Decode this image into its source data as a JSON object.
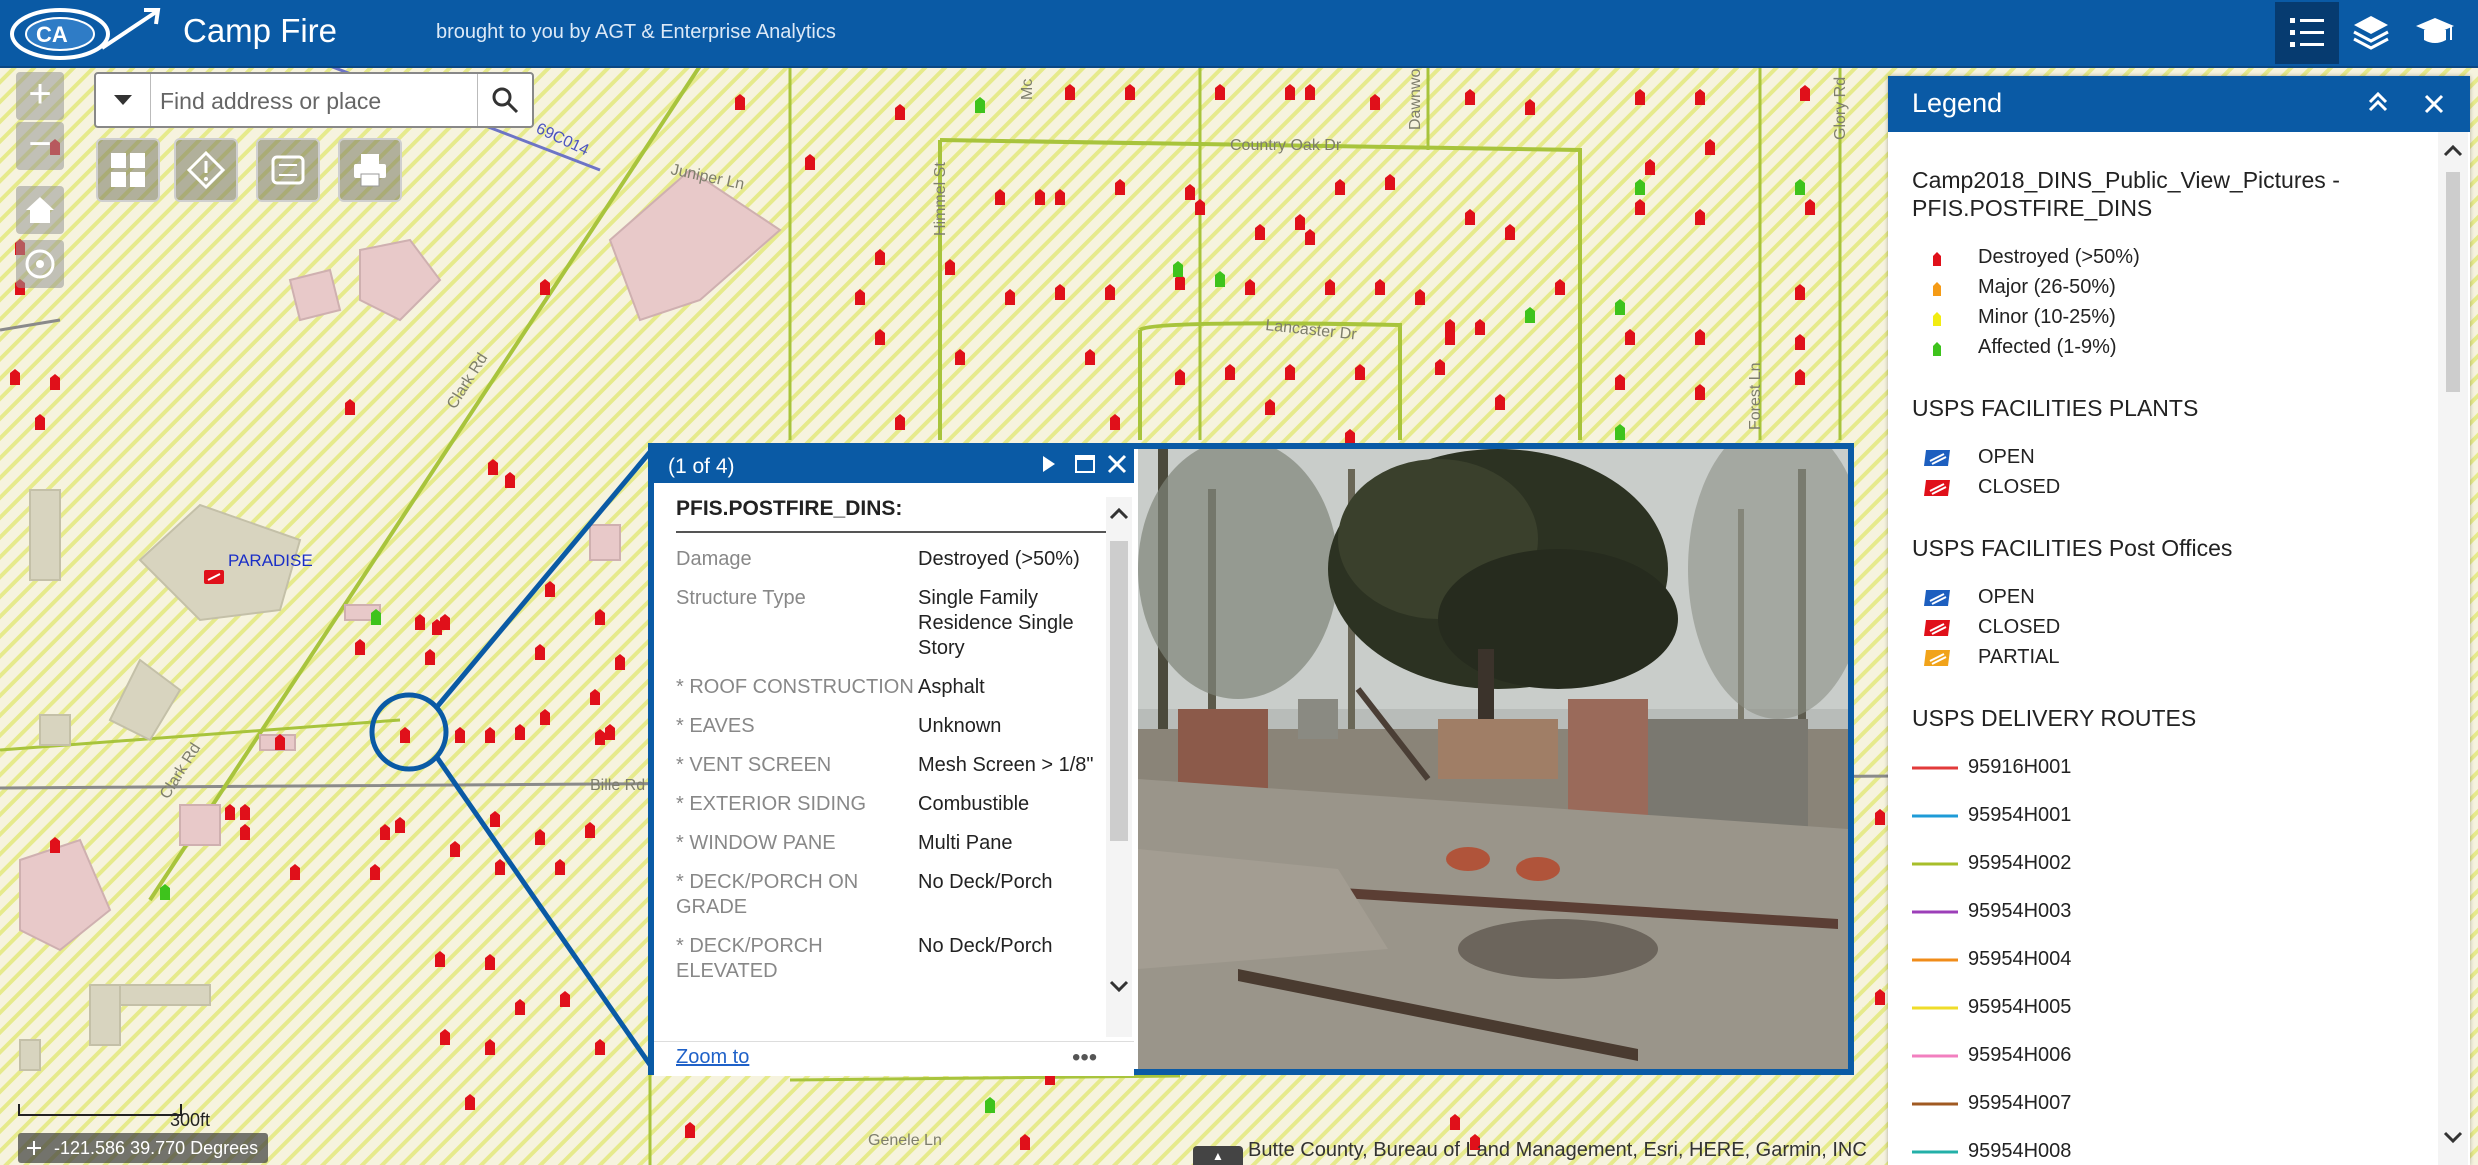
{
  "header": {
    "title": "Camp Fire",
    "subtitle": "brought to you by AGT & Enterprise Analytics",
    "logo_icon": "agency-logo-icon",
    "buttons": [
      "legend-icon",
      "layers-icon",
      "about-icon"
    ]
  },
  "search": {
    "placeholder": "Find address or place"
  },
  "map": {
    "place_label": "PARADISE",
    "scale_label": "300ft",
    "coordinates": "-121.586 39.770 Degrees",
    "attribution": "Butte County, Bureau of Land Management, Esri, HERE, Garmin, INC",
    "street_labels": [
      "Juniper Ln",
      "Country Oak Dr",
      "Lancaster Dr",
      "Clark Rd",
      "Himmel St",
      "Bille Rd",
      "Forest Ln",
      "Glory Rd",
      "Genele Ln",
      "Clark Rd",
      "Dawnwood",
      "Mc",
      "69C014"
    ],
    "colors": {
      "destroyed": "#e0101a",
      "affected": "#3ec31c",
      "roads": "#a8c43c",
      "hatch": "#e9ec8a",
      "brand": "#0a5aa5"
    }
  },
  "popup": {
    "count": "(1 of 4)",
    "title": "PFIS.POSTFIRE_DINS:",
    "attributes": [
      {
        "key": "Damage",
        "value": "Destroyed (>50%)"
      },
      {
        "key": "Structure Type",
        "value": "Single Family Residence Single Story"
      },
      {
        "key": "* ROOF CONSTRUCTION",
        "value": "Asphalt"
      },
      {
        "key": "* EAVES",
        "value": "Unknown"
      },
      {
        "key": "* VENT SCREEN",
        "value": "Mesh Screen > 1/8\""
      },
      {
        "key": "* EXTERIOR SIDING",
        "value": "Combustible"
      },
      {
        "key": "* WINDOW PANE",
        "value": "Multi Pane"
      },
      {
        "key": "* DECK/PORCH ON GRADE",
        "value": "No Deck/Porch"
      },
      {
        "key": "* DECK/PORCH ELEVATED",
        "value": "No Deck/Porch"
      }
    ],
    "zoom_to": "Zoom to",
    "more": "•••"
  },
  "legend": {
    "title": "Legend",
    "sections": [
      {
        "heading": "Camp2018_DINS_Public_View_Pictures - PFIS.POSTFIRE_DINS",
        "items": [
          {
            "label": "Destroyed (>50%)",
            "color": "#e0101a",
            "icon": "house-marker-icon"
          },
          {
            "label": "Major (26-50%)",
            "color": "#f59b16",
            "icon": "house-marker-icon"
          },
          {
            "label": "Minor (10-25%)",
            "color": "#f2ec12",
            "icon": "house-marker-icon"
          },
          {
            "label": "Affected (1-9%)",
            "color": "#3ec31c",
            "icon": "house-marker-icon"
          }
        ]
      },
      {
        "heading": "USPS FACILITIES PLANTS",
        "items": [
          {
            "label": "OPEN",
            "color": "#1d5fbf",
            "icon": "usps-eagle-icon"
          },
          {
            "label": "CLOSED",
            "color": "#e0101a",
            "icon": "usps-eagle-icon"
          }
        ]
      },
      {
        "heading": "USPS FACILITIES Post Offices",
        "items": [
          {
            "label": "OPEN",
            "color": "#1d5fbf",
            "icon": "usps-eagle-icon"
          },
          {
            "label": "CLOSED",
            "color": "#e0101a",
            "icon": "usps-eagle-icon"
          },
          {
            "label": "PARTIAL",
            "color": "#f1a31a",
            "icon": "usps-eagle-icon"
          }
        ]
      },
      {
        "heading": "USPS DELIVERY ROUTES",
        "items": [
          {
            "label": "95916H001",
            "color": "#e23a3a",
            "icon": "line-icon"
          },
          {
            "label": "95954H001",
            "color": "#1e9bd7",
            "icon": "line-icon"
          },
          {
            "label": "95954H002",
            "color": "#a7be2a",
            "icon": "line-icon"
          },
          {
            "label": "95954H003",
            "color": "#9c3fb8",
            "icon": "line-icon"
          },
          {
            "label": "95954H004",
            "color": "#f08c1a",
            "icon": "line-icon"
          },
          {
            "label": "95954H005",
            "color": "#efdc2a",
            "icon": "line-icon"
          },
          {
            "label": "95954H006",
            "color": "#f27fbf",
            "icon": "line-icon"
          },
          {
            "label": "95954H007",
            "color": "#a05a22",
            "icon": "line-icon"
          },
          {
            "label": "95954H008",
            "color": "#23b0a8",
            "icon": "line-icon"
          }
        ]
      }
    ]
  }
}
